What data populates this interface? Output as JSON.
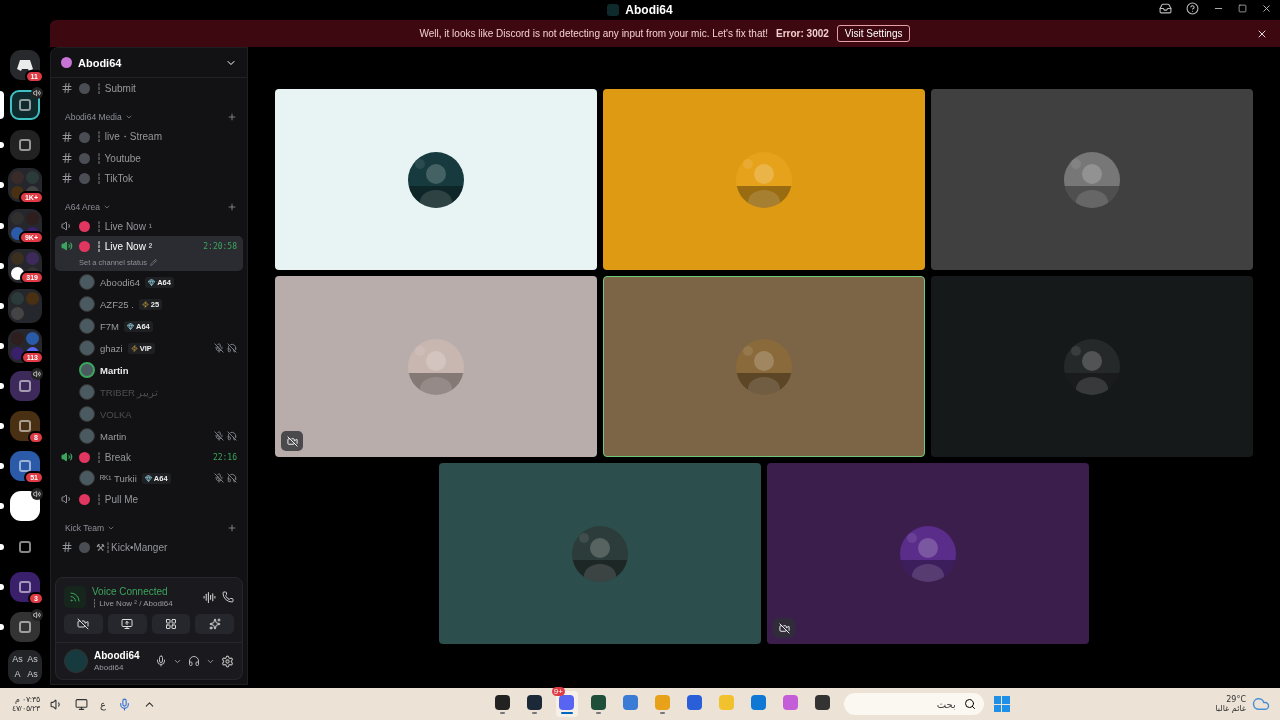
{
  "title_bar": {
    "title": "Abodi64"
  },
  "banner": {
    "message": "Well, it looks like Discord is not detecting any input from your mic. Let's fix that!",
    "error": "Error: 3002",
    "action": "Visit Settings"
  },
  "servers": [
    {
      "kind": "home",
      "badge": "11",
      "selected": false,
      "unread": false,
      "voice": false
    },
    {
      "kind": "server",
      "selected": true,
      "unread": false,
      "voice": true
    },
    {
      "kind": "server",
      "selected": false,
      "unread": true,
      "voice": false
    },
    {
      "kind": "folder",
      "badge": "1K+",
      "selected": false,
      "unread": true,
      "voice": false
    },
    {
      "kind": "folder",
      "badge": "9K+",
      "selected": false,
      "unread": true,
      "voice": false
    },
    {
      "kind": "folder",
      "badge": "319",
      "selected": false,
      "unread": true,
      "voice": false
    },
    {
      "kind": "folder",
      "selected": false,
      "unread": true,
      "voice": false
    },
    {
      "kind": "folder",
      "badge": "113",
      "selected": false,
      "unread": true,
      "voice": false
    },
    {
      "kind": "server",
      "selected": false,
      "unread": true,
      "voice": true
    },
    {
      "kind": "server",
      "badge": "8",
      "selected": false,
      "unread": true,
      "voice": false
    },
    {
      "kind": "server",
      "badge": "51",
      "selected": false,
      "unread": true,
      "voice": false
    },
    {
      "kind": "server",
      "selected": false,
      "unread": true,
      "voice": true
    },
    {
      "kind": "server",
      "selected": false,
      "unread": true,
      "voice": false
    },
    {
      "kind": "server",
      "badge": "3",
      "selected": false,
      "unread": true,
      "voice": false
    },
    {
      "kind": "server",
      "selected": false,
      "unread": true,
      "voice": true
    },
    {
      "kind": "folder",
      "labels": [
        "As",
        "As",
        "A",
        "As"
      ],
      "selected": false,
      "unread": false,
      "voice": false
    }
  ],
  "sidebar": {
    "server_name": "Abodi64",
    "items": [
      {
        "kind": "text",
        "name": "┆ Submit"
      },
      {
        "kind": "category",
        "name": "Abodi64 Media"
      },
      {
        "kind": "text",
        "name": "┆ live・Stream"
      },
      {
        "kind": "text",
        "name": "┆ Youtube"
      },
      {
        "kind": "text",
        "name": "┆ TikTok"
      },
      {
        "kind": "category",
        "name": "A64 Area"
      },
      {
        "kind": "voice",
        "name": "┆ Live Now ¹",
        "selected": false,
        "active": false
      },
      {
        "kind": "voice",
        "name": "┆ Live Now ²",
        "selected": true,
        "active": true,
        "timer": "2:20:58",
        "status": "Set a channel status",
        "members": [
          {
            "name": "Aboodi64",
            "tag": {
              "kind": "gem",
              "label": "A64"
            },
            "speaking": false,
            "muted": false,
            "dimmed": false
          },
          {
            "name": "AZF25 .",
            "tag": {
              "kind": "bolt",
              "label": "25"
            },
            "speaking": false,
            "muted": false,
            "dimmed": false
          },
          {
            "name": "F7M",
            "tag": {
              "kind": "gem",
              "label": "A64"
            },
            "speaking": false,
            "muted": false,
            "dimmed": false
          },
          {
            "name": "ghazi",
            "tag": {
              "kind": "bolt",
              "label": "VIP"
            },
            "speaking": false,
            "muted": true,
            "dimmed": false
          },
          {
            "name": "Martin",
            "speaking": true,
            "muted": false,
            "dimmed": false
          },
          {
            "name": "TRIBER تريبر",
            "speaking": false,
            "muted": false,
            "dimmed": true
          },
          {
            "name": "VOLKA",
            "speaking": false,
            "muted": false,
            "dimmed": true
          },
          {
            "name": "Martin",
            "speaking": false,
            "muted": true,
            "dimmed": false
          }
        ]
      },
      {
        "kind": "voice",
        "name": "┆ Break",
        "selected": false,
        "active": true,
        "timer": "22:16",
        "members": [
          {
            "name": "ᴿᴷ¹ Turkii",
            "tag": {
              "kind": "gem",
              "label": "A64"
            },
            "speaking": false,
            "muted": true,
            "dimmed": false
          }
        ]
      },
      {
        "kind": "voice",
        "name": "┆ Pull Me",
        "selected": false,
        "active": false
      },
      {
        "kind": "category",
        "name": "Kick Team"
      },
      {
        "kind": "text",
        "name": "⚒┆Kick•Manger"
      }
    ]
  },
  "voice_panel": {
    "status": "Voice Connected",
    "channel": "┆ Live Now ² / Abodi64"
  },
  "user_panel": {
    "name": "Aboodi64",
    "subtitle": "Abodi64"
  },
  "tiles": [
    {
      "color": "#e8f4f3",
      "selected": false,
      "camera_off": false
    },
    {
      "color": "#dd9a12",
      "selected": false,
      "camera_off": false
    },
    {
      "color": "#404040",
      "selected": false,
      "camera_off": false
    },
    {
      "color": "#b8adab",
      "selected": false,
      "camera_off": true
    },
    {
      "color": "#7b6546",
      "selected": true,
      "camera_off": false
    },
    {
      "color": "#15191a",
      "selected": false,
      "camera_off": false
    },
    {
      "color": "#2c4e4d",
      "selected": false,
      "camera_off": false
    },
    {
      "color": "#3b1e4c",
      "selected": false,
      "camera_off": true
    }
  ],
  "taskbar": {
    "time": "٠٧:٣٥ م",
    "date": "٤٧/٠٥/٢٣",
    "language": "ع",
    "search": {
      "placeholder": "بحث"
    },
    "apps": [
      {
        "running": true,
        "focused": false
      },
      {
        "running": true,
        "focused": false
      },
      {
        "running": true,
        "focused": true,
        "badge": "9+"
      },
      {
        "running": true,
        "focused": false
      },
      {
        "running": false,
        "focused": false
      },
      {
        "running": true,
        "focused": false
      },
      {
        "running": false,
        "focused": false
      },
      {
        "running": false,
        "focused": false
      },
      {
        "running": false,
        "focused": false
      },
      {
        "running": false,
        "focused": false
      },
      {
        "running": false,
        "focused": false
      }
    ],
    "weather": {
      "temperature": "29°C",
      "condition": "غائم غالبا"
    }
  }
}
